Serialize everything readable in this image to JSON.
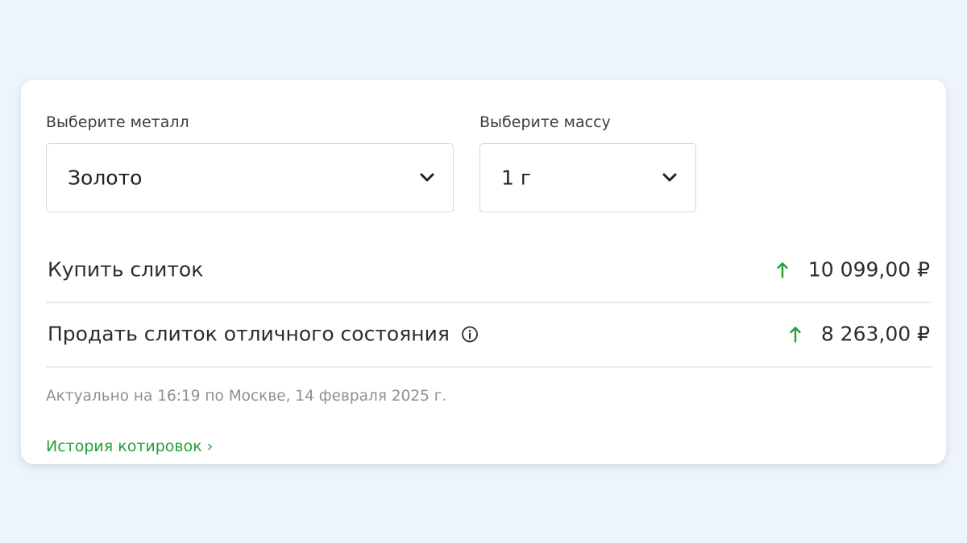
{
  "metal_select": {
    "label": "Выберите металл",
    "value": "Золото"
  },
  "mass_select": {
    "label": "Выберите массу",
    "value": "1 г"
  },
  "rows": [
    {
      "label": "Купить слиток",
      "price": "10 099,00 ₽",
      "trend": "up"
    },
    {
      "label": "Продать слиток отличного состояния",
      "price": "8 263,00 ₽",
      "trend": "up",
      "has_info": true
    }
  ],
  "updated_text": "Актуально на 16:19 по Москве, 14 февраля 2025 г.",
  "history_link": "История котировок ›",
  "colors": {
    "accent_green": "#21a038",
    "background": "#eef4fd",
    "card": "#ffffff",
    "muted_text": "#8c9096"
  },
  "icons": {
    "dropdown": "chevron-down-icon",
    "trend": "arrow-up-icon",
    "info": "info-icon"
  }
}
